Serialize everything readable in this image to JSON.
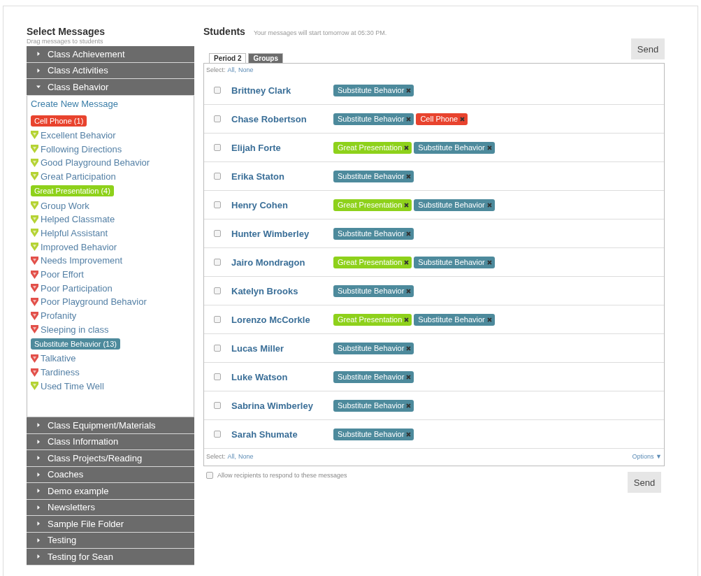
{
  "messages_panel": {
    "title": "Select Messages",
    "subtitle": "Drag messages to students",
    "categories": [
      {
        "label": "Class Achievement",
        "expanded": false
      },
      {
        "label": "Class Activities",
        "expanded": false
      },
      {
        "label": "Class Behavior",
        "expanded": true,
        "create_link": "Create New Message",
        "items": [
          {
            "kind": "tag",
            "label": "Cell Phone (1)",
            "color": "#e8432e"
          },
          {
            "kind": "message",
            "label": "Excellent Behavior",
            "color": "#b5d334"
          },
          {
            "kind": "message",
            "label": "Following Directions",
            "color": "#b5d334"
          },
          {
            "kind": "message",
            "label": "Good Playground Behavior",
            "color": "#b5d334"
          },
          {
            "kind": "message",
            "label": "Great Participation",
            "color": "#b5d334"
          },
          {
            "kind": "tag",
            "label": "Great Presentation (4)",
            "color": "#8ed11b"
          },
          {
            "kind": "message",
            "label": "Group Work",
            "color": "#b5d334"
          },
          {
            "kind": "message",
            "label": "Helped Classmate",
            "color": "#b5d334"
          },
          {
            "kind": "message",
            "label": "Helpful Assistant",
            "color": "#b5d334"
          },
          {
            "kind": "message",
            "label": "Improved Behavior",
            "color": "#b5d334"
          },
          {
            "kind": "message",
            "label": "Needs Improvement",
            "color": "#e2504a"
          },
          {
            "kind": "message",
            "label": "Poor Effort",
            "color": "#e2504a"
          },
          {
            "kind": "message",
            "label": "Poor Participation",
            "color": "#e2504a"
          },
          {
            "kind": "message",
            "label": "Poor Playground Behavior",
            "color": "#e2504a"
          },
          {
            "kind": "message",
            "label": "Profanity",
            "color": "#e2504a"
          },
          {
            "kind": "message",
            "label": "Sleeping in class",
            "color": "#e2504a"
          },
          {
            "kind": "tag",
            "label": "Substitute Behavior (13)",
            "color": "#4d8a9c"
          },
          {
            "kind": "message",
            "label": "Talkative",
            "color": "#e2504a"
          },
          {
            "kind": "message",
            "label": "Tardiness",
            "color": "#e2504a"
          },
          {
            "kind": "message",
            "label": "Used Time Well",
            "color": "#b5d334"
          }
        ]
      },
      {
        "label": "Class Equipment/Materials",
        "expanded": false
      },
      {
        "label": "Class Information",
        "expanded": false
      },
      {
        "label": "Class Projects/Reading",
        "expanded": false
      },
      {
        "label": "Coaches",
        "expanded": false
      },
      {
        "label": "Demo example",
        "expanded": false
      },
      {
        "label": "Newsletters",
        "expanded": false
      },
      {
        "label": "Sample File Folder",
        "expanded": false
      },
      {
        "label": "Testing",
        "expanded": false
      },
      {
        "label": "Testing for Sean",
        "expanded": false
      }
    ]
  },
  "students_panel": {
    "title": "Students",
    "note": "Your messages will start tomorrow at 05:30 PM.",
    "send_top": "Send",
    "tabs": [
      {
        "label": "Period 2",
        "selected": true
      },
      {
        "label": "Groups",
        "selected": false
      }
    ],
    "select_top": {
      "label": "Select:",
      "all": "All,",
      "none": "None"
    },
    "rows": [
      {
        "name": "Brittney Clark",
        "checked": false,
        "tags": [
          {
            "label": "Substitute Behavior",
            "color": "#4d8a9c"
          }
        ]
      },
      {
        "name": "Chase Robertson",
        "checked": false,
        "tags": [
          {
            "label": "Substitute Behavior",
            "color": "#4d8a9c"
          },
          {
            "label": "Cell Phone",
            "color": "#e8432e"
          }
        ]
      },
      {
        "name": "Elijah Forte",
        "checked": false,
        "tags": [
          {
            "label": "Great Presentation",
            "color": "#8ed11b"
          },
          {
            "label": "Substitute Behavior",
            "color": "#4d8a9c"
          }
        ]
      },
      {
        "name": "Erika Staton",
        "checked": false,
        "tags": [
          {
            "label": "Substitute Behavior",
            "color": "#4d8a9c"
          }
        ]
      },
      {
        "name": "Henry Cohen",
        "checked": false,
        "tags": [
          {
            "label": "Great Presentation",
            "color": "#8ed11b"
          },
          {
            "label": "Substitute Behavior",
            "color": "#4d8a9c"
          }
        ]
      },
      {
        "name": "Hunter Wimberley",
        "checked": false,
        "tags": [
          {
            "label": "Substitute Behavior",
            "color": "#4d8a9c"
          }
        ]
      },
      {
        "name": "Jairo Mondragon",
        "checked": false,
        "tags": [
          {
            "label": "Great Presentation",
            "color": "#8ed11b"
          },
          {
            "label": "Substitute Behavior",
            "color": "#4d8a9c"
          }
        ]
      },
      {
        "name": "Katelyn Brooks",
        "checked": false,
        "tags": [
          {
            "label": "Substitute Behavior",
            "color": "#4d8a9c"
          }
        ]
      },
      {
        "name": "Lorenzo McCorkle",
        "checked": false,
        "tags": [
          {
            "label": "Great Presentation",
            "color": "#8ed11b"
          },
          {
            "label": "Substitute Behavior",
            "color": "#4d8a9c"
          }
        ]
      },
      {
        "name": "Lucas Miller",
        "checked": false,
        "tags": [
          {
            "label": "Substitute Behavior",
            "color": "#4d8a9c"
          }
        ]
      },
      {
        "name": "Luke Watson",
        "checked": false,
        "tags": [
          {
            "label": "Substitute Behavior",
            "color": "#4d8a9c"
          }
        ]
      },
      {
        "name": "Sabrina Wimberley",
        "checked": false,
        "tags": [
          {
            "label": "Substitute Behavior",
            "color": "#4d8a9c"
          }
        ]
      },
      {
        "name": "Sarah Shumate",
        "checked": false,
        "tags": [
          {
            "label": "Substitute Behavior",
            "color": "#4d8a9c"
          }
        ]
      }
    ],
    "select_bottom": {
      "label": "Select:",
      "all": "All,",
      "none": "None"
    },
    "options": "Options ▼",
    "allow_responses": {
      "label": "Allow recipients to respond to these messages",
      "checked": false
    },
    "send_bottom": "Send"
  }
}
